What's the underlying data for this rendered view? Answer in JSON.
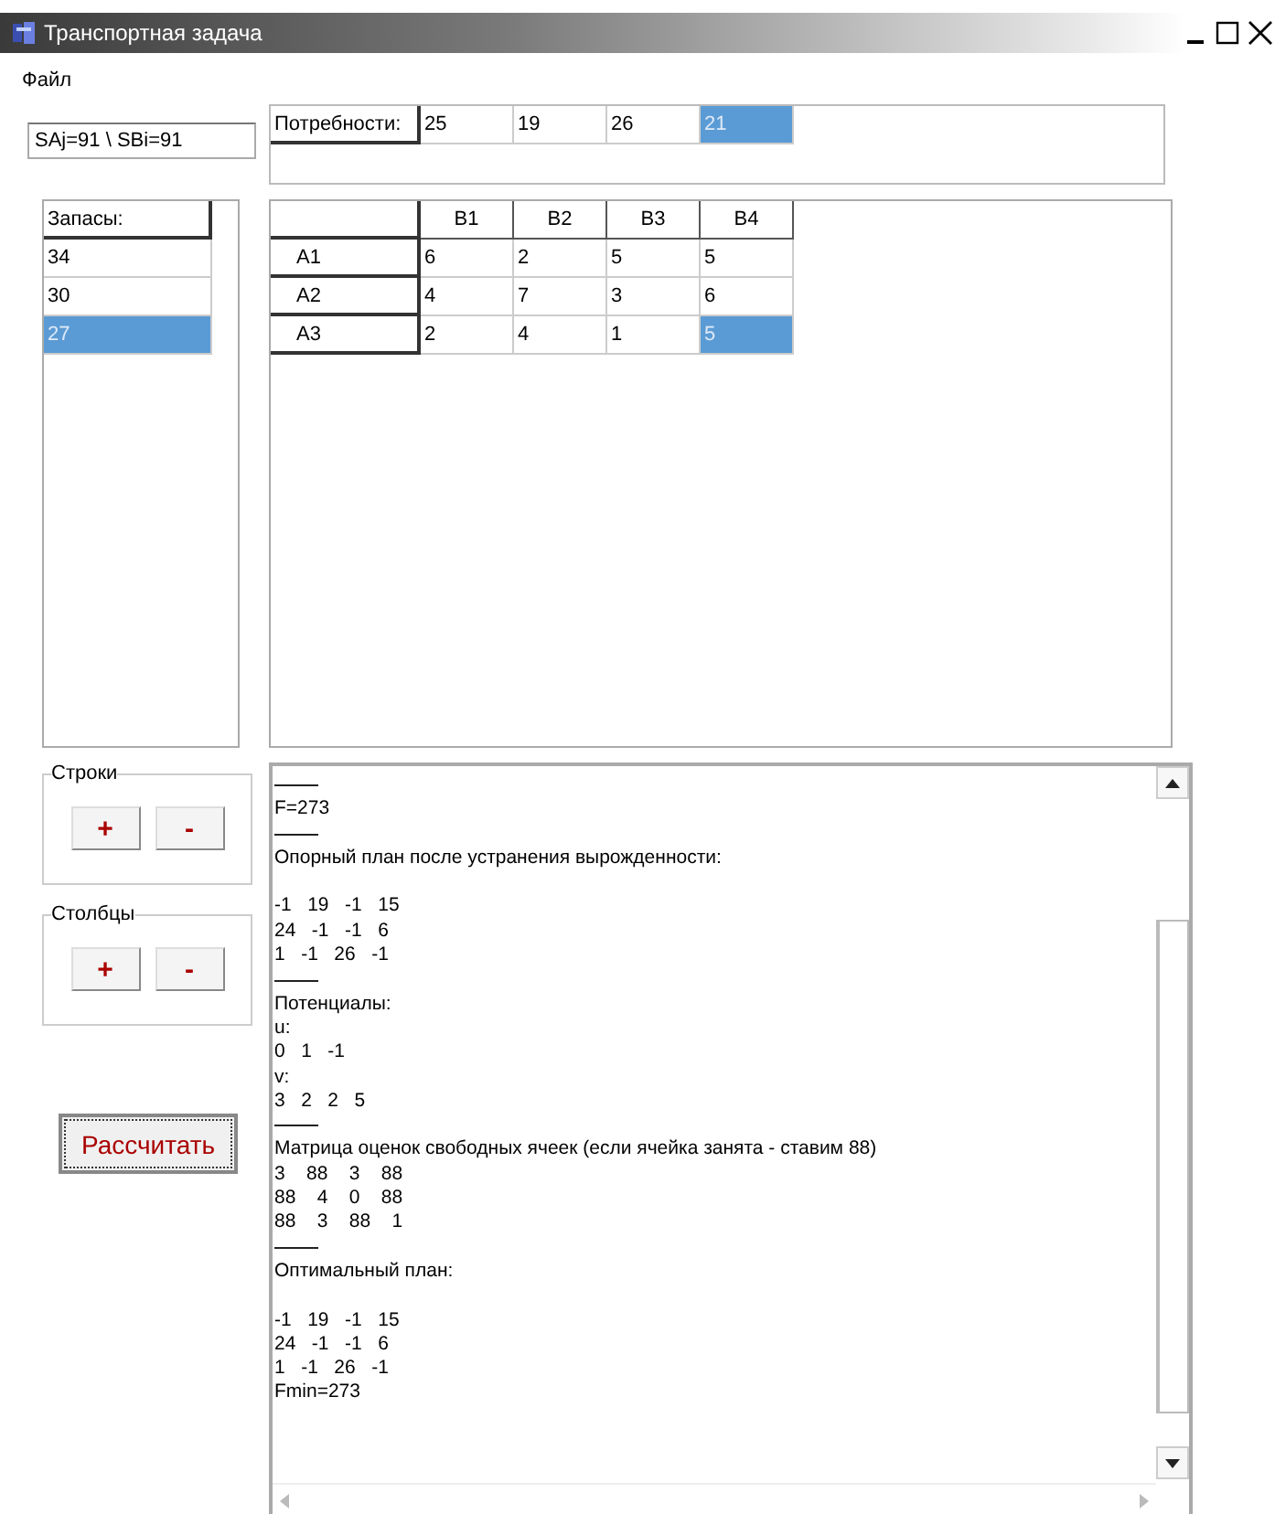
{
  "window": {
    "title": "Транспортная задача"
  },
  "menu": [
    {
      "label": "Файл"
    }
  ],
  "sums_field": {
    "value": "SAj=91 \\ SBi=91"
  },
  "needs": {
    "label": "Потребности:",
    "cells": [
      {
        "text": "25",
        "selected": false
      },
      {
        "text": "19",
        "selected": false
      },
      {
        "text": "26",
        "selected": false
      },
      {
        "text": "21",
        "selected": true
      }
    ]
  },
  "supplies": {
    "header": "Запасы:",
    "cells": [
      {
        "text": "34",
        "selected": false
      },
      {
        "text": "30",
        "selected": false
      },
      {
        "text": "27",
        "selected": true
      }
    ]
  },
  "costs": {
    "columns": [
      "B1",
      "B2",
      "B3",
      "B4"
    ],
    "rows": [
      {
        "label": "A1",
        "cells": [
          {
            "text": "6",
            "selected": false
          },
          {
            "text": "2",
            "selected": false
          },
          {
            "text": "5",
            "selected": false
          },
          {
            "text": "5",
            "selected": false
          }
        ]
      },
      {
        "label": "A2",
        "cells": [
          {
            "text": "4",
            "selected": false
          },
          {
            "text": "7",
            "selected": false
          },
          {
            "text": "3",
            "selected": false
          },
          {
            "text": "6",
            "selected": false
          }
        ]
      },
      {
        "label": "A3",
        "cells": [
          {
            "text": "2",
            "selected": false
          },
          {
            "text": "4",
            "selected": false
          },
          {
            "text": "1",
            "selected": false
          },
          {
            "text": "5",
            "selected": true
          }
        ]
      }
    ]
  },
  "groups": [
    {
      "title": "Строки",
      "buttons": [
        "+",
        "-"
      ]
    },
    {
      "title": "Столбцы",
      "buttons": [
        "+",
        "-"
      ]
    }
  ],
  "calculate_button": {
    "label": "Рассчитать",
    "focused": true
  },
  "output": {
    "lines": [
      {
        "kind": "rule"
      },
      {
        "kind": "text",
        "text": "F=273"
      },
      {
        "kind": "rule"
      },
      {
        "kind": "text",
        "text": "Опорный план после устранения вырожденности:"
      },
      {
        "kind": "blank"
      },
      {
        "kind": "text",
        "text": "-1   19   -1   15"
      },
      {
        "kind": "text",
        "text": "24   -1   -1   6"
      },
      {
        "kind": "text",
        "text": "1   -1   26   -1"
      },
      {
        "kind": "rule"
      },
      {
        "kind": "text",
        "text": "Потенциалы:"
      },
      {
        "kind": "text",
        "text": "u:"
      },
      {
        "kind": "text",
        "text": "0   1   -1"
      },
      {
        "kind": "text",
        "text": "v:"
      },
      {
        "kind": "text",
        "text": "3   2   2   5"
      },
      {
        "kind": "rule"
      },
      {
        "kind": "text",
        "text": "Матрица оценок свободных ячеек (если ячейка занята - ставим 88)"
      },
      {
        "kind": "text",
        "text": "3    88    3    88"
      },
      {
        "kind": "text",
        "text": "88    4    0    88"
      },
      {
        "kind": "text",
        "text": "88    3    88    1"
      },
      {
        "kind": "rule"
      },
      {
        "kind": "text",
        "text": "Оптимальный план:"
      },
      {
        "kind": "blank"
      },
      {
        "kind": "text",
        "text": "-1   19   -1   15"
      },
      {
        "kind": "text",
        "text": "24   -1   -1   6"
      },
      {
        "kind": "text",
        "text": "1   -1   26   -1"
      },
      {
        "kind": "text",
        "text": "Fmin=273"
      }
    ]
  }
}
